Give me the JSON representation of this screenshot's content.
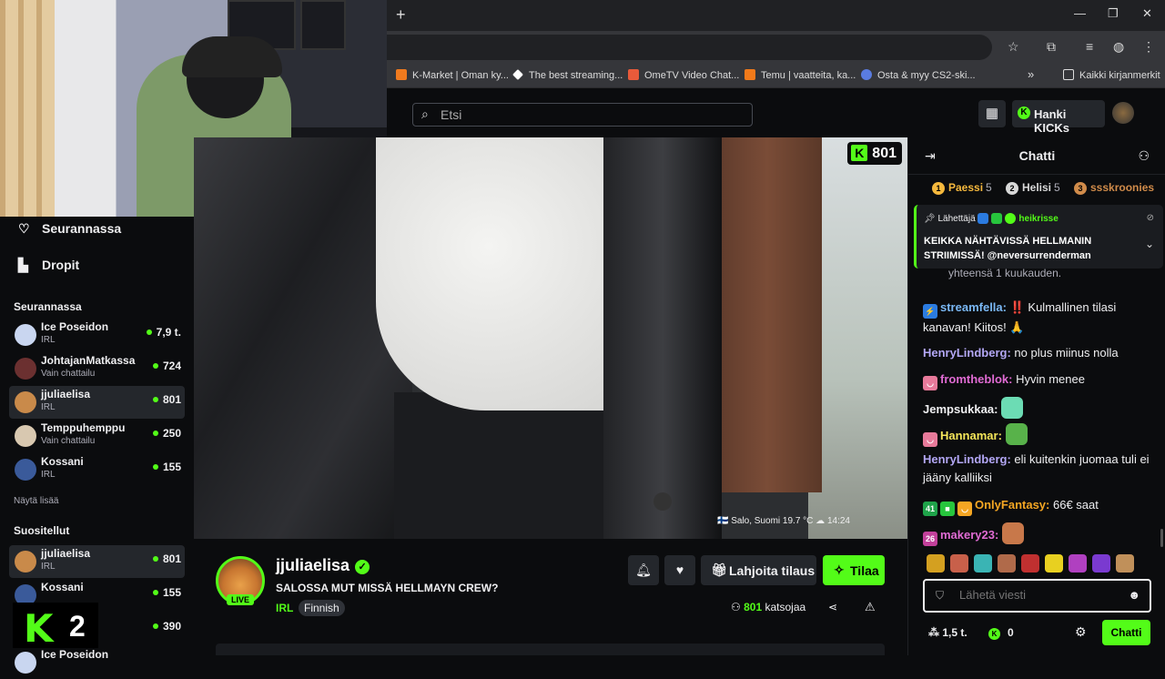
{
  "browser": {
    "newtab_glyph": "+",
    "window_controls": [
      "—",
      "❐",
      "✕"
    ],
    "bookmarks": [
      {
        "label": "K-Market | Oman ky...",
        "color": "#f07a1e",
        "icon": "K"
      },
      {
        "label": "The best streaming...",
        "color": "#ffffff",
        "icon": "◆"
      },
      {
        "label": "OmeTV Video Chat...",
        "color": "#e85a3a",
        "icon": "▣"
      },
      {
        "label": "Temu | vaatteita, ka...",
        "color": "#f27a1a",
        "icon": "T"
      },
      {
        "label": "Osta & myy CS2-ski...",
        "color": "#5a7ce0",
        "icon": "☁"
      }
    ],
    "overflow_glyph": "»",
    "all_bookmarks": "Kaikki kirjanmerkit"
  },
  "header": {
    "search_placeholder": "Etsi",
    "kicks_label": "Hanki KICKs"
  },
  "sidebar": {
    "nav": [
      {
        "label": "Seurannassa",
        "icon": "heart-icon",
        "glyph": "♡"
      },
      {
        "label": "Dropit",
        "icon": "chart-icon",
        "glyph": "▙"
      }
    ],
    "following_title": "Seurannassa",
    "following": [
      {
        "name": "Ice Poseidon",
        "category": "IRL",
        "viewers": "7,9 t.",
        "color": "#c9d6f0"
      },
      {
        "name": "JohtajanMatkassa",
        "category": "Vain chattailu",
        "viewers": "724",
        "color": "#6b3030"
      },
      {
        "name": "jjuliaelisa",
        "category": "IRL",
        "viewers": "801",
        "color": "#c98a4a",
        "active": true
      },
      {
        "name": "Temppuhemppu",
        "category": "Vain chattailu",
        "viewers": "250",
        "color": "#d8c8b0"
      },
      {
        "name": "Kossani",
        "category": "IRL",
        "viewers": "155",
        "color": "#3a5a9a"
      }
    ],
    "show_more": "Näytä lisää",
    "recommended_title": "Suositellut",
    "recommended": [
      {
        "name": "jjuliaelisa",
        "category": "IRL",
        "viewers": "801",
        "color": "#c98a4a",
        "active": true
      },
      {
        "name": "Kossani",
        "category": "",
        "viewers": "155",
        "color": "#3a5a9a"
      },
      {
        "name": "",
        "category": "",
        "viewers": "390",
        "color": "#333"
      },
      {
        "name": "Ice Poseidon",
        "category": "",
        "viewers": "",
        "color": "#c9d6f0"
      }
    ],
    "logo_text": "2"
  },
  "video": {
    "viewer_badge": "801",
    "weather": "🇫🇮 Salo, Suomi  19.7 °C  ☁  14:24"
  },
  "stream": {
    "streamer": "jjuliaelisa",
    "live": "LIVE",
    "title": "SALOSSA MUT MISSÄ HELLMAYN CREW?",
    "category": "IRL",
    "tag": "Finnish",
    "gift_label": "Lahjoita tilaus",
    "subscribe_label": "Tilaa",
    "viewers_count": "801",
    "viewers_label": "katsojaa"
  },
  "chat": {
    "title": "Chatti",
    "leaderboard": [
      {
        "rank": "1",
        "name": "Paessi",
        "count": "5",
        "color": "#f5b83d"
      },
      {
        "rank": "2",
        "name": "Helisi",
        "count": "5",
        "color": "#d8d8d8"
      },
      {
        "rank": "3",
        "name": "ssskroonies",
        "count": "",
        "color": "#d08b4a"
      }
    ],
    "pinned": {
      "prefix": "Lähettäjä",
      "by": "heikrisse",
      "message": "KEIKKA NÄHTÄVISSÄ HELLMANIN STRIIMISSÄ! @neversurrenderman"
    },
    "stub": "yhteensä 1 kuukauden.",
    "messages": [
      {
        "user": "streamfella",
        "color": "#7ab8f5",
        "text": " ‼️ Kulmallinen tilasi kanavan! Kiitos! 🙏",
        "badges": [
          {
            "c": "#2b7be0",
            "t": "⚡"
          }
        ]
      },
      {
        "user": "HenryLindberg",
        "color": "#b3a7f5",
        "text": " no plus miinus nolla",
        "badges": []
      },
      {
        "user": "fromtheblok",
        "color": "#e06bd3",
        "text": " Hyvin menee",
        "badges": [
          {
            "c": "#e87a9a",
            "t": "◡"
          }
        ]
      },
      {
        "user": "Jempsukkaa",
        "color": "#efeff1",
        "text": "",
        "badges": [],
        "emote": "#6cdcb4"
      },
      {
        "user": "Hannamar",
        "color": "#f5e65a",
        "text": "",
        "badges": [
          {
            "c": "#e87a9a",
            "t": "◡"
          }
        ],
        "emote": "#58b24a"
      },
      {
        "user": "HenryLindberg",
        "color": "#b3a7f5",
        "text": " eli kuitenkin juomaa tuli ei jääny kalliiksi",
        "badges": []
      },
      {
        "user": "OnlyFantasy",
        "color": "#f5a623",
        "text": " 66€ saat",
        "badges": [
          {
            "c": "#1fa34a",
            "t": "41"
          },
          {
            "c": "#27c53d",
            "t": "■"
          },
          {
            "c": "#f5a623",
            "t": "◡"
          }
        ]
      },
      {
        "user": "makery23",
        "color": "#e06bd3",
        "text": "",
        "badges": [
          {
            "c": "#c2409a",
            "t": "26"
          }
        ],
        "emote": "#c8784a"
      }
    ],
    "emote_row": [
      "#d4a020",
      "#c8604a",
      "#3ab4b4",
      "#b06a4a",
      "#c03030",
      "#e8d020",
      "#b040c0",
      "#7a3ad0",
      "#c0905a"
    ],
    "input_placeholder": "Lähetä viesti",
    "points": "1,5 t.",
    "kicks": "0",
    "chat_button": "Chatti"
  }
}
